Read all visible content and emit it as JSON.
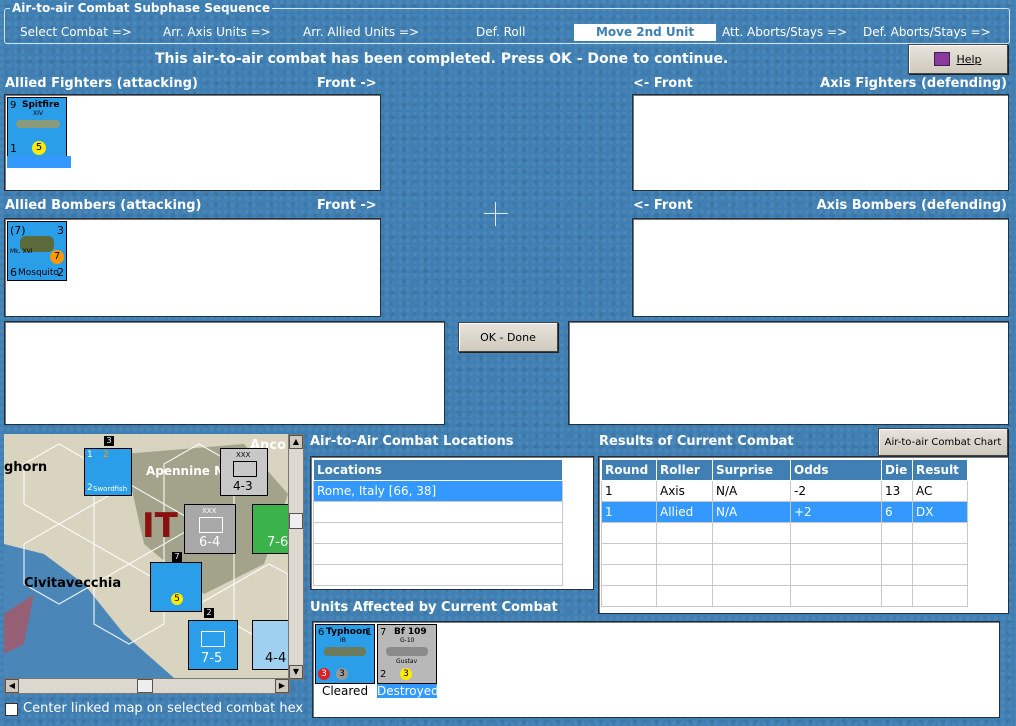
{
  "sequence": {
    "title": "Air-to-air Combat Subphase Sequence",
    "steps": [
      "Select Combat =>",
      "Arr. Axis Units =>",
      "Arr. Allied Units =>",
      "Def. Roll",
      "Move 2nd Unit",
      "Att. Aborts/Stays =>",
      "Def. Aborts/Stays =>"
    ]
  },
  "status_message": "This air-to-air combat has been completed.  Press OK - Done to continue.",
  "help_label": "Help",
  "panels": {
    "allied_fighters": "Allied Fighters (attacking)",
    "axis_fighters": "Axis Fighters (defending)",
    "allied_bombers": "Allied Bombers (attacking)",
    "axis_bombers": "Axis Bombers (defending)",
    "front_right": "Front ->",
    "front_left": "<- Front"
  },
  "counters": {
    "spitfire": {
      "name": "Spitfire",
      "sub": "XIV",
      "tl": "9",
      "bl": "1",
      "val": "5"
    },
    "mosquito": {
      "name": "Mosquito",
      "sub": "Mk. XVI",
      "tl": "(7)",
      "tr": "3",
      "bl": "6",
      "br": "2",
      "val": "7"
    },
    "typhoon": {
      "name": "Typhoon",
      "sub": "IB",
      "tl": "6",
      "tr": "1",
      "b1": "3",
      "b2": "3",
      "status": "Cleared"
    },
    "bf109": {
      "name": "Bf 109",
      "sub": "G-10",
      "sub2": "Gustav",
      "tl": "7",
      "bl": "2",
      "val": "3",
      "status": "Destroyed"
    }
  },
  "ok_done_label": "OK - Done",
  "locations": {
    "title": "Air-to-Air Combat Locations",
    "header": "Locations",
    "rows": [
      "Rome, Italy [66, 38]"
    ]
  },
  "results": {
    "title": "Results of Current Combat",
    "chart_button": "Air-to-air Combat Chart",
    "headers": [
      "Round",
      "Roller",
      "Surprise",
      "Odds",
      "Die",
      "Result"
    ],
    "rows": [
      [
        "1",
        "Axis",
        "N/A",
        "-2",
        "13",
        "AC"
      ],
      [
        "1",
        "Allied",
        "N/A",
        "+2",
        "6",
        "DX"
      ]
    ]
  },
  "units_affected_title": "Units Affected by Current Combat",
  "center_map_label": "Center linked map on selected combat hex",
  "map": {
    "labels": [
      "ghorn",
      "Apennine M",
      "Civitavecchia",
      "IT",
      "Anco"
    ],
    "units": [
      "4-3",
      "6-4",
      "7-5",
      "4-4",
      "7-6"
    ],
    "small_nums": [
      "1",
      "3",
      "2",
      "2",
      "7",
      "2",
      "5"
    ],
    "unit_name": "Swordfish",
    "xxx": "XXX"
  },
  "colors": {
    "bg": "#3f7fb3",
    "allied": "#2a9ee8",
    "axis": "#b8b8b8",
    "selected": "#3399ff"
  }
}
